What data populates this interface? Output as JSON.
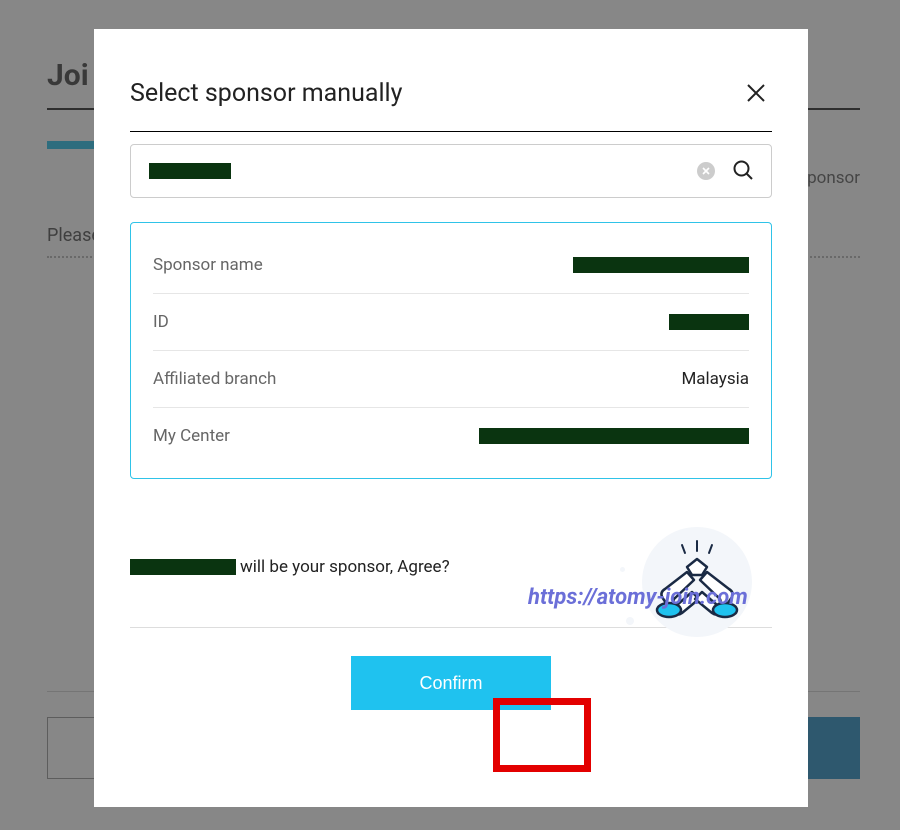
{
  "background": {
    "title_partial": "Joi",
    "sponsor_text": "ponsor",
    "please_text": "Please"
  },
  "modal": {
    "title": "Select sponsor manually",
    "search_value": "",
    "info": {
      "rows": [
        {
          "label": "Sponsor name",
          "value_redacted": true,
          "value": "",
          "redact_class": "redact-1"
        },
        {
          "label": "ID",
          "value_redacted": true,
          "value": "",
          "redact_class": "redact-2"
        },
        {
          "label": "Affiliated branch",
          "value_redacted": false,
          "value": "Malaysia",
          "redact_class": ""
        },
        {
          "label": "My Center",
          "value_redacted": true,
          "value": "",
          "redact_class": "redact-3"
        }
      ]
    },
    "agree_suffix": "will be your sponsor, Agree?",
    "confirm_label": "Confirm"
  },
  "watermark": "https://atomy-join.com"
}
